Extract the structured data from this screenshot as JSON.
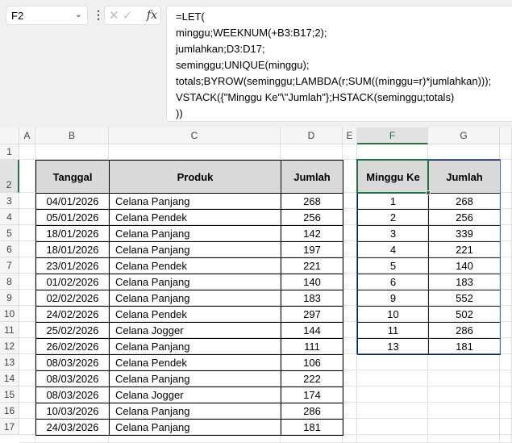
{
  "name_box": "F2",
  "formula_lines": [
    "=LET(",
    "minggu;WEEKNUM(+B3:B17;2);",
    "jumlahkan;D3:D17;",
    "seminggu;UNIQUE(minggu);",
    "totals;BYROW(seminggu;LAMBDA(r;SUM((minggu=r)*jumlahkan)));",
    "VSTACK({\"Minggu Ke\"\\\"Jumlah\"};HSTACK(seminggu;totals)",
    "))"
  ],
  "columns": [
    "A",
    "B",
    "C",
    "D",
    "E",
    "F",
    "G"
  ],
  "rows": [
    "1",
    "2",
    "3",
    "4",
    "5",
    "6",
    "7",
    "8",
    "9",
    "10",
    "11",
    "12",
    "13",
    "14",
    "15",
    "16",
    "17"
  ],
  "source_headers": [
    "Tanggal",
    "Produk",
    "Jumlah"
  ],
  "source_rows": [
    [
      "04/01/2026",
      "Celana Panjang",
      "268"
    ],
    [
      "05/01/2026",
      "Celana Pendek",
      "256"
    ],
    [
      "18/01/2026",
      "Celana Panjang",
      "142"
    ],
    [
      "18/01/2026",
      "Celana Panjang",
      "197"
    ],
    [
      "23/01/2026",
      "Celana Pendek",
      "221"
    ],
    [
      "01/02/2026",
      "Celana Panjang",
      "140"
    ],
    [
      "02/02/2026",
      "Celana Panjang",
      "183"
    ],
    [
      "24/02/2026",
      "Celana Pendek",
      "297"
    ],
    [
      "25/02/2026",
      "Celana Jogger",
      "144"
    ],
    [
      "26/02/2026",
      "Celana Panjang",
      "111"
    ],
    [
      "08/03/2026",
      "Celana Pendek",
      "106"
    ],
    [
      "08/03/2026",
      "Celana Panjang",
      "222"
    ],
    [
      "08/03/2026",
      "Celana Jogger",
      "174"
    ],
    [
      "10/03/2026",
      "Celana Panjang",
      "286"
    ],
    [
      "24/03/2026",
      "Celana Panjang",
      "181"
    ]
  ],
  "result_headers": [
    "Minggu Ke",
    "Jumlah"
  ],
  "result_rows": [
    [
      "1",
      "268"
    ],
    [
      "2",
      "256"
    ],
    [
      "3",
      "339"
    ],
    [
      "4",
      "221"
    ],
    [
      "5",
      "140"
    ],
    [
      "6",
      "183"
    ],
    [
      "9",
      "552"
    ],
    [
      "10",
      "502"
    ],
    [
      "11",
      "286"
    ],
    [
      "13",
      "181"
    ]
  ],
  "selected_column": "F",
  "selected_row": "2",
  "accent": "#217346"
}
